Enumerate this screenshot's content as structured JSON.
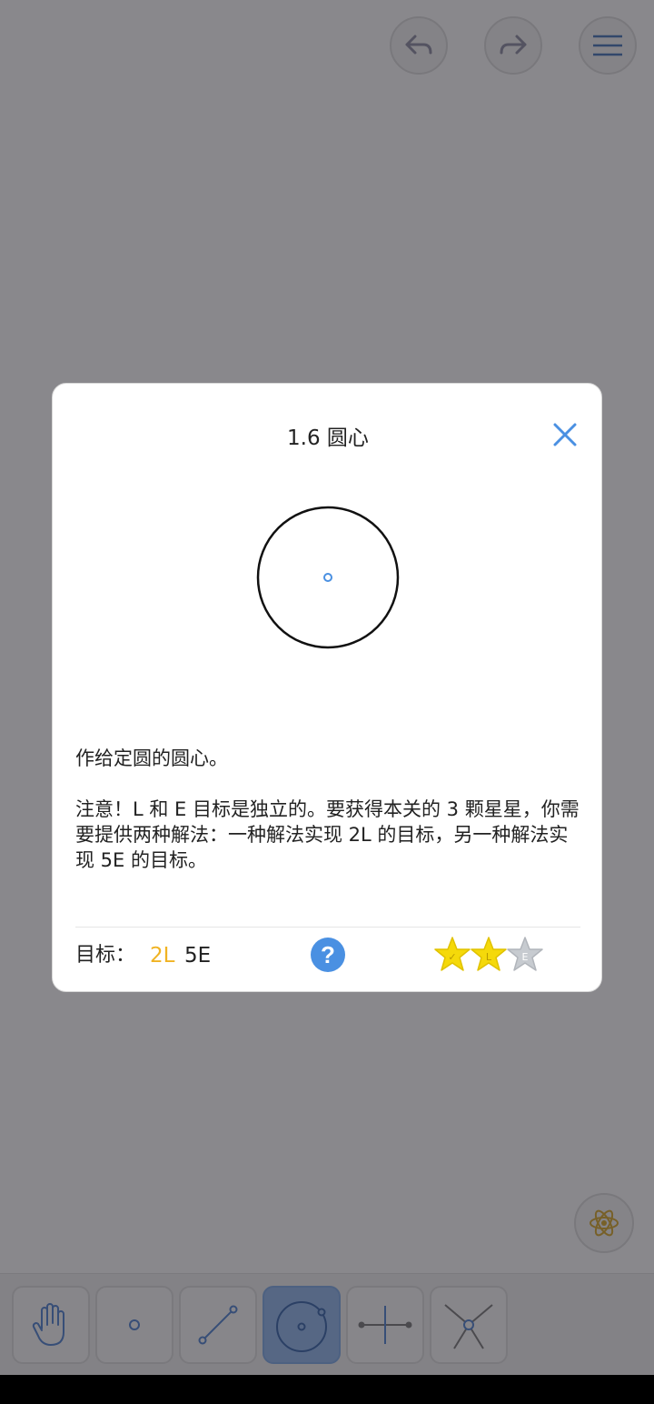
{
  "top_bar": {
    "undo": "undo-icon",
    "redo": "redo-icon",
    "menu": "menu-icon"
  },
  "dialog": {
    "title": "1.6 圆心",
    "description": "作给定圆的圆心。",
    "note": "注意！L 和 E 目标是独立的。要获得本关的 3 颗星星，你需要提供两种解法：一种解法实现 2L 的目标，另一种解法实现 5E 的目标。",
    "goal_label": "目标：",
    "goal_l": "2L",
    "goal_e": "5E",
    "help_label": "?",
    "stars": [
      {
        "earned": true,
        "label": "✓"
      },
      {
        "earned": true,
        "label": "L"
      },
      {
        "earned": false,
        "label": "E"
      }
    ]
  },
  "toolbar": {
    "tools": [
      {
        "name": "hand-tool",
        "active": false
      },
      {
        "name": "point-tool",
        "active": false
      },
      {
        "name": "line-tool",
        "active": false
      },
      {
        "name": "circle-tool",
        "active": true
      },
      {
        "name": "perpendicular-tool",
        "active": false
      },
      {
        "name": "intersect-tool",
        "active": false
      }
    ]
  },
  "colors": {
    "accent": "#4a90e2",
    "star_gold": "#f5d90a",
    "goal_l": "#f0b323",
    "active_tool": "#8eb6ee"
  }
}
